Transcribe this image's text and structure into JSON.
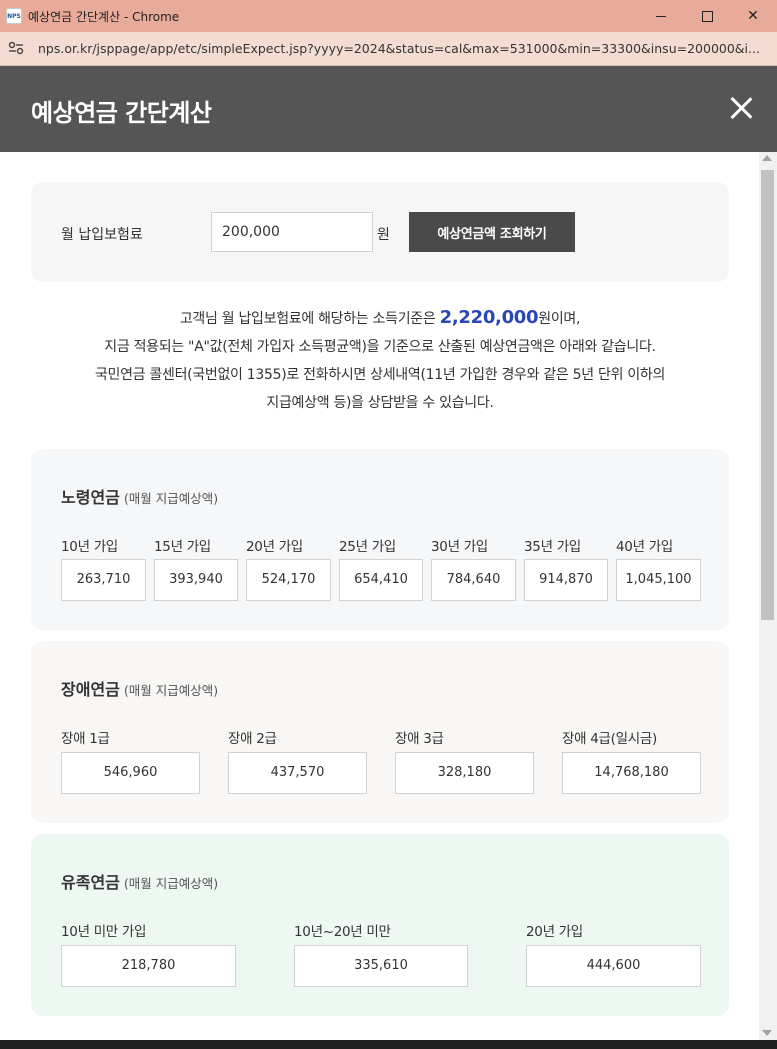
{
  "window": {
    "title": "예상연금 간단계산 - Chrome",
    "favicon_text": "NPS",
    "url": "nps.or.kr/jsppage/app/etc/simpleExpect.jsp?yyyy=2024&status=cal&max=531000&min=33300&insu=200000&i..."
  },
  "popup": {
    "title": "예상연금 간단계산"
  },
  "form": {
    "premium_label": "월 납입보험료",
    "premium_value": "200,000",
    "unit": "원",
    "query_button": "예상연금액 조회하기"
  },
  "description": {
    "line1_prefix": "고객님 월 납입보험료에 해당하는 소득기준은 ",
    "income_amount": "2,220,000",
    "line1_suffix": "원이며,",
    "line2": "지금 적용되는 \"A\"값(전체 가입자 소득평균액)을 기준으로 산출된 예상연금액은 아래와 같습니다.",
    "line3": "국민연금 콜센터(국번없이 1355)로 전화하시면 상세내역(11년 가입한 경우와 같은 5년 단위 이하의",
    "line4": "지급예상액 등)을 상담받을 수 있습니다."
  },
  "old_age_pension": {
    "title": "노령연금",
    "subtitle": "(매월 지급예상액)",
    "items": [
      {
        "label": "10년 가입",
        "value": "263,710"
      },
      {
        "label": "15년 가입",
        "value": "393,940"
      },
      {
        "label": "20년 가입",
        "value": "524,170"
      },
      {
        "label": "25년 가입",
        "value": "654,410"
      },
      {
        "label": "30년 가입",
        "value": "784,640"
      },
      {
        "label": "35년 가입",
        "value": "914,870"
      },
      {
        "label": "40년 가입",
        "value": "1,045,100"
      }
    ]
  },
  "disability_pension": {
    "title": "장애연금",
    "subtitle": "(매월 지급예상액)",
    "items": [
      {
        "label": "장애 1급",
        "value": "546,960"
      },
      {
        "label": "장애 2급",
        "value": "437,570"
      },
      {
        "label": "장애 3급",
        "value": "328,180"
      },
      {
        "label": "장애 4급(일시금)",
        "value": "14,768,180"
      }
    ]
  },
  "survivor_pension": {
    "title": "유족연금",
    "subtitle": "(매월 지급예상액)",
    "items": [
      {
        "label": "10년 미만 가입",
        "value": "218,780"
      },
      {
        "label": "10년~20년 미만",
        "value": "335,610"
      },
      {
        "label": "20년 가입",
        "value": "444,600"
      }
    ]
  },
  "colors": {
    "header_bg": "#555555",
    "highlight": "#2b47b5",
    "button_bg": "#4a4a4a",
    "titlebar_bg": "#e8ab9a"
  }
}
